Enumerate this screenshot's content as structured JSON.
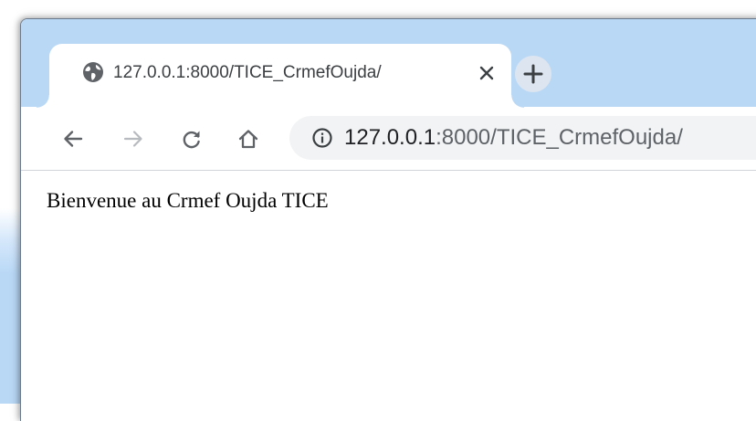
{
  "tab": {
    "title": "127.0.0.1:8000/TICE_CrmefOujda/",
    "favicon": "globe-icon",
    "close_icon": "close-icon"
  },
  "new_tab": {
    "icon": "plus-icon"
  },
  "toolbar": {
    "back_icon": "arrow-left-icon",
    "forward_icon": "arrow-right-icon",
    "reload_icon": "reload-icon",
    "home_icon": "home-icon"
  },
  "address_bar": {
    "info_icon": "info-icon",
    "url_host": "127.0.0.1",
    "url_rest": ":8000/TICE_CrmefOujda/"
  },
  "page": {
    "text": "Bienvenue au Crmef Oujda TICE"
  },
  "colors": {
    "tabstrip": "#b9d8f6",
    "toolbar": "#ffffff",
    "omnibox": "#f1f3f4",
    "icon": "#5f6368",
    "icon_disabled": "#b7bbc0"
  }
}
